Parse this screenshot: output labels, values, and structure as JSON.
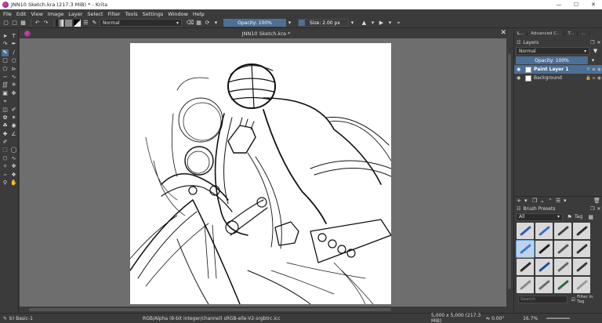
{
  "window": {
    "title": "JNN10 Sketch.kra (217.3 MiB)  * - Krita",
    "min": "—",
    "max": "☐",
    "close": "✕"
  },
  "menu": [
    "File",
    "Edit",
    "View",
    "Image",
    "Layer",
    "Select",
    "Filter",
    "Tools",
    "Settings",
    "Window",
    "Help"
  ],
  "toolbar": {
    "blend_mode": "Normal",
    "opacity": "Opacity: 100%",
    "size": "Size: 2.00 px"
  },
  "document": {
    "tab_title": "JNN10 Sketch.kra *",
    "close": "✕"
  },
  "right_panel": {
    "tabs": [
      "L...",
      "Advanced C...",
      "T...",
      "..."
    ],
    "layers": {
      "title": "Layers",
      "blend_mode": "Normal",
      "opacity": "Opacity:  100%",
      "items": [
        {
          "name": "Paint Layer 1",
          "active": true
        },
        {
          "name": "Background",
          "active": false
        }
      ]
    },
    "brush_presets": {
      "title": "Brush Presets",
      "filter": "All",
      "tag": "Tag",
      "search_placeholder": "Search",
      "filter_in_tag": "Filter in Tag",
      "colors": [
        "#2d5fb0",
        "#3a6fc4",
        "#444444",
        "#2e2e2e",
        "#3f7ad0",
        "#1e1e1e",
        "#555555",
        "#333333",
        "#2a2a2a",
        "#1d4f9e",
        "#666666",
        "#3a3a3a",
        "#888888",
        "#6b6b6b",
        "#2a6a3a",
        "#999999"
      ]
    }
  },
  "status": {
    "brush": "b) Basic-1",
    "color_info": "RGB/Alpha (8-bit integer/channel)  sRGB-elle-V2-srgbtrc.icc",
    "dimensions": "5,000 x 5,000 (217.3 MiB)",
    "rotation": "0.00°",
    "zoom": "16.7%"
  }
}
